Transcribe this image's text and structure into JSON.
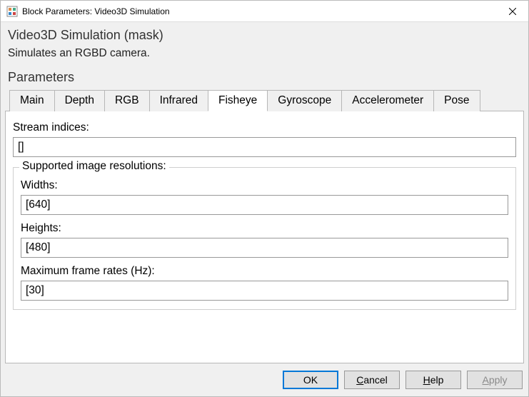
{
  "window": {
    "title": "Block Parameters: Video3D Simulation"
  },
  "mask": {
    "title": "Video3D Simulation (mask)",
    "description": "Simulates an RGBD camera."
  },
  "parameters_label": "Parameters",
  "tabs": [
    {
      "label": "Main"
    },
    {
      "label": "Depth"
    },
    {
      "label": "RGB"
    },
    {
      "label": "Infrared"
    },
    {
      "label": "Fisheye"
    },
    {
      "label": "Gyroscope"
    },
    {
      "label": "Accelerometer"
    },
    {
      "label": "Pose"
    }
  ],
  "active_tab_index": 4,
  "fields": {
    "stream_indices": {
      "label": "Stream indices:",
      "value": "[]"
    },
    "group_label": "Supported image resolutions:",
    "widths": {
      "label": "Widths:",
      "value": "[640]"
    },
    "heights": {
      "label": "Heights:",
      "value": "[480]"
    },
    "max_frame_rates": {
      "label": "Maximum frame rates (Hz):",
      "value": "[30]"
    }
  },
  "buttons": {
    "ok": "OK",
    "cancel": "Cancel",
    "help": "Help",
    "apply": "Apply"
  }
}
